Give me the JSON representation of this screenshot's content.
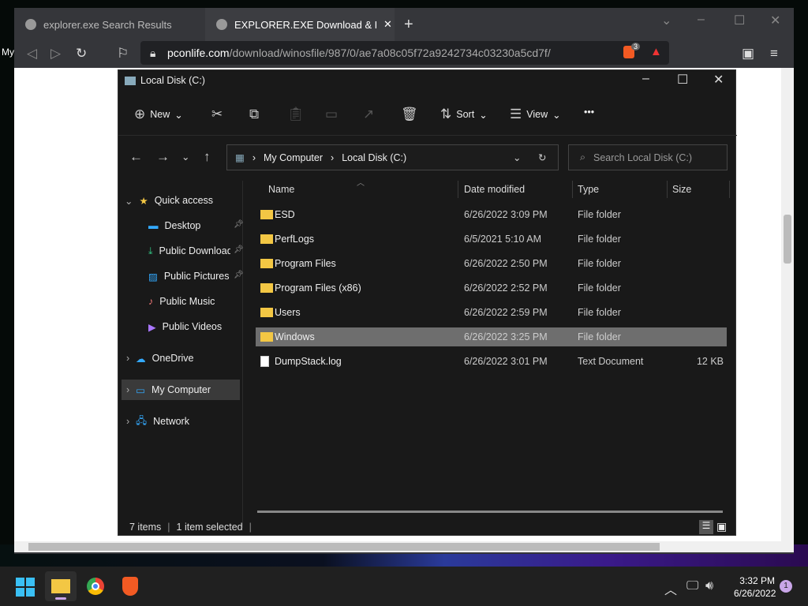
{
  "browser": {
    "tabs": [
      {
        "label": "explorer.exe Search Results"
      },
      {
        "label": "EXPLORER.EXE Download & Fix Fo"
      }
    ],
    "url_domain": "pconlife.com",
    "url_path": "/download/winosfile/987/0/ae7a08c05f72a9242734c03230a5cd7f/",
    "brave_badge": "3",
    "page_left_text": "My"
  },
  "explorer": {
    "title": "Local Disk (C:)",
    "toolbar": {
      "new": "New",
      "sort": "Sort",
      "view": "View",
      "more": "•••"
    },
    "breadcrumb": [
      "My Computer",
      "Local Disk (C:)"
    ],
    "search_placeholder": "Search Local Disk (C:)",
    "nav": {
      "quick_access": "Quick access",
      "items": [
        "Desktop",
        "Public Downloads",
        "Public Pictures",
        "Public Music",
        "Public Videos"
      ],
      "onedrive": "OneDrive",
      "my_computer": "My Computer",
      "network": "Network"
    },
    "columns": {
      "name": "Name",
      "date": "Date modified",
      "type": "Type",
      "size": "Size"
    },
    "rows": [
      {
        "name": "ESD",
        "date": "6/26/2022 3:09 PM",
        "type": "File folder",
        "size": ""
      },
      {
        "name": "PerfLogs",
        "date": "6/5/2021 5:10 AM",
        "type": "File folder",
        "size": ""
      },
      {
        "name": "Program Files",
        "date": "6/26/2022 2:50 PM",
        "type": "File folder",
        "size": ""
      },
      {
        "name": "Program Files (x86)",
        "date": "6/26/2022 2:52 PM",
        "type": "File folder",
        "size": ""
      },
      {
        "name": "Users",
        "date": "6/26/2022 2:59 PM",
        "type": "File folder",
        "size": ""
      },
      {
        "name": "Windows",
        "date": "6/26/2022 3:25 PM",
        "type": "File folder",
        "size": ""
      },
      {
        "name": "DumpStack.log",
        "date": "6/26/2022 3:01 PM",
        "type": "Text Document",
        "size": "12 KB"
      }
    ],
    "status": {
      "count": "7 items",
      "selected": "1 item selected"
    }
  },
  "taskbar": {
    "time": "3:32 PM",
    "date": "6/26/2022",
    "notifications": "1"
  }
}
